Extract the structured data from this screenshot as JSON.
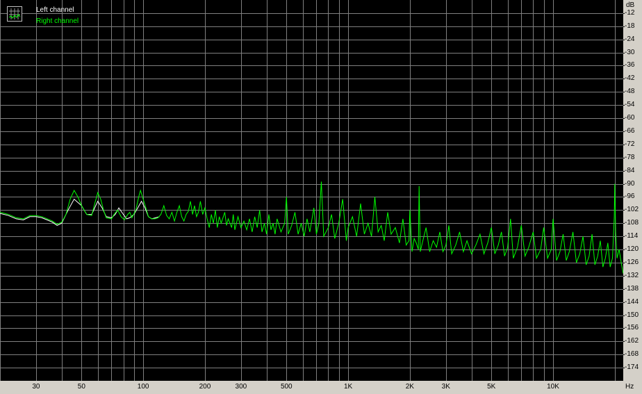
{
  "chart_data": {
    "type": "line",
    "xlabel": "Hz",
    "ylabel": "dB",
    "xscale": "log",
    "xlim": [
      20,
      22000
    ],
    "ylim": [
      -180,
      -6
    ],
    "grid": true,
    "legend_position": "top-left",
    "background_color": "#000000",
    "grid_color": "#808080",
    "x_tick_labels": [
      {
        "value": 30,
        "label": "30"
      },
      {
        "value": 50,
        "label": "50"
      },
      {
        "value": 100,
        "label": "100"
      },
      {
        "value": 200,
        "label": "200"
      },
      {
        "value": 300,
        "label": "300"
      },
      {
        "value": 500,
        "label": "500"
      },
      {
        "value": 1000,
        "label": "1K"
      },
      {
        "value": 2000,
        "label": "2K"
      },
      {
        "value": 3000,
        "label": "3K"
      },
      {
        "value": 5000,
        "label": "5K"
      },
      {
        "value": 10000,
        "label": "10K"
      }
    ],
    "x_minor_ticks": [
      20,
      40,
      60,
      70,
      80,
      90,
      400,
      600,
      700,
      800,
      900,
      4000,
      6000,
      7000,
      8000,
      9000,
      20000
    ],
    "y_ticks": [
      -12,
      -18,
      -24,
      -30,
      -36,
      -42,
      -48,
      -54,
      -60,
      -66,
      -72,
      -78,
      -84,
      -90,
      -96,
      -102,
      -108,
      -114,
      -120,
      -126,
      -132,
      -138,
      -144,
      -150,
      -156,
      -162,
      -168,
      -174
    ],
    "series": [
      {
        "name": "Left channel",
        "color": "#ffffff",
        "points": [
          [
            20,
            -103.5
          ],
          [
            22,
            -104.5
          ],
          [
            24,
            -106
          ],
          [
            26,
            -106.5
          ],
          [
            28,
            -105
          ],
          [
            30,
            -105
          ],
          [
            32,
            -105.5
          ],
          [
            34,
            -106.5
          ],
          [
            36,
            -107.5
          ],
          [
            38,
            -109
          ],
          [
            40,
            -108
          ],
          [
            43,
            -102
          ],
          [
            46,
            -97
          ],
          [
            50,
            -100
          ],
          [
            53,
            -104
          ],
          [
            56,
            -104
          ],
          [
            60,
            -98
          ],
          [
            63,
            -101
          ],
          [
            66,
            -105
          ],
          [
            70,
            -105.5
          ],
          [
            73,
            -104
          ],
          [
            76,
            -101
          ],
          [
            80,
            -104
          ],
          [
            83,
            -106
          ],
          [
            86,
            -105.5
          ],
          [
            90,
            -104
          ],
          [
            94,
            -101
          ],
          [
            98,
            -98
          ],
          [
            102,
            -101
          ],
          [
            106,
            -105
          ],
          [
            110,
            -106
          ],
          [
            115,
            -105.5
          ],
          [
            120,
            -105
          ]
        ]
      },
      {
        "name": "Right channel",
        "color": "#00ff00",
        "points": [
          [
            20,
            -103
          ],
          [
            22,
            -104
          ],
          [
            24,
            -105.5
          ],
          [
            26,
            -106
          ],
          [
            28,
            -104.5
          ],
          [
            30,
            -104.5
          ],
          [
            32,
            -105
          ],
          [
            34,
            -106
          ],
          [
            36,
            -107
          ],
          [
            38,
            -108.5
          ],
          [
            40,
            -107.5
          ],
          [
            42,
            -104
          ],
          [
            44,
            -97
          ],
          [
            46,
            -93
          ],
          [
            48,
            -96
          ],
          [
            50,
            -100
          ],
          [
            53,
            -104
          ],
          [
            56,
            -104.5
          ],
          [
            58,
            -99
          ],
          [
            60,
            -94
          ],
          [
            62,
            -97
          ],
          [
            64,
            -102
          ],
          [
            66,
            -105.5
          ],
          [
            70,
            -106
          ],
          [
            72,
            -104
          ],
          [
            75,
            -102
          ],
          [
            78,
            -105
          ],
          [
            81,
            -106.5
          ],
          [
            84,
            -104
          ],
          [
            86,
            -103
          ],
          [
            88,
            -105.5
          ],
          [
            92,
            -102
          ],
          [
            95,
            -96
          ],
          [
            97,
            -93
          ],
          [
            100,
            -97
          ],
          [
            103,
            -101
          ],
          [
            106,
            -105
          ],
          [
            110,
            -106
          ],
          [
            114,
            -106
          ],
          [
            118,
            -105.5
          ],
          [
            122,
            -104
          ],
          [
            126,
            -100
          ],
          [
            130,
            -104.5
          ],
          [
            134,
            -106
          ],
          [
            138,
            -103
          ],
          [
            142,
            -107
          ],
          [
            146,
            -103
          ],
          [
            150,
            -100
          ],
          [
            154,
            -105
          ],
          [
            158,
            -107
          ],
          [
            162,
            -104
          ],
          [
            166,
            -102.5
          ],
          [
            170,
            -98
          ],
          [
            174,
            -104
          ],
          [
            178,
            -100
          ],
          [
            182,
            -105
          ],
          [
            186,
            -103
          ],
          [
            190,
            -98
          ],
          [
            195,
            -104
          ],
          [
            200,
            -101
          ],
          [
            205,
            -106
          ],
          [
            210,
            -110
          ],
          [
            215,
            -104
          ],
          [
            220,
            -108
          ],
          [
            225,
            -102
          ],
          [
            230,
            -110
          ],
          [
            235,
            -105
          ],
          [
            240,
            -108
          ],
          [
            250,
            -103
          ],
          [
            255,
            -109
          ],
          [
            260,
            -106
          ],
          [
            270,
            -110
          ],
          [
            275,
            -104
          ],
          [
            280,
            -111
          ],
          [
            290,
            -105
          ],
          [
            300,
            -110
          ],
          [
            310,
            -107
          ],
          [
            320,
            -111
          ],
          [
            330,
            -106
          ],
          [
            340,
            -112
          ],
          [
            350,
            -105
          ],
          [
            360,
            -110
          ],
          [
            370,
            -102
          ],
          [
            380,
            -112
          ],
          [
            390,
            -108
          ],
          [
            400,
            -113
          ],
          [
            410,
            -104
          ],
          [
            420,
            -111
          ],
          [
            430,
            -108
          ],
          [
            440,
            -113
          ],
          [
            450,
            -106
          ],
          [
            470,
            -112
          ],
          [
            490,
            -108
          ],
          [
            500,
            -96
          ],
          [
            510,
            -113
          ],
          [
            530,
            -109
          ],
          [
            550,
            -103
          ],
          [
            570,
            -113
          ],
          [
            590,
            -108
          ],
          [
            610,
            -114
          ],
          [
            630,
            -106
          ],
          [
            650,
            -112
          ],
          [
            680,
            -101
          ],
          [
            700,
            -113
          ],
          [
            720,
            -108
          ],
          [
            740,
            -89
          ],
          [
            760,
            -114
          ],
          [
            800,
            -110
          ],
          [
            830,
            -104
          ],
          [
            860,
            -115
          ],
          [
            900,
            -108
          ],
          [
            940,
            -97
          ],
          [
            980,
            -116
          ],
          [
            1000,
            -110
          ],
          [
            1050,
            -105
          ],
          [
            1100,
            -114
          ],
          [
            1150,
            -99
          ],
          [
            1200,
            -113
          ],
          [
            1250,
            -108
          ],
          [
            1300,
            -114
          ],
          [
            1350,
            -96
          ],
          [
            1400,
            -112
          ],
          [
            1450,
            -109
          ],
          [
            1500,
            -116
          ],
          [
            1560,
            -103
          ],
          [
            1620,
            -113
          ],
          [
            1700,
            -110
          ],
          [
            1780,
            -117
          ],
          [
            1850,
            -106
          ],
          [
            1920,
            -118
          ],
          [
            1980,
            -116
          ],
          [
            2000,
            -102
          ],
          [
            2050,
            -121
          ],
          [
            2100,
            -115
          ],
          [
            2150,
            -117
          ],
          [
            2200,
            -120
          ],
          [
            2220,
            -91
          ],
          [
            2250,
            -121
          ],
          [
            2300,
            -117
          ],
          [
            2400,
            -110
          ],
          [
            2500,
            -121
          ],
          [
            2600,
            -116
          ],
          [
            2700,
            -119
          ],
          [
            2800,
            -112
          ],
          [
            2900,
            -121
          ],
          [
            3000,
            -118
          ],
          [
            3100,
            -109
          ],
          [
            3200,
            -122
          ],
          [
            3350,
            -118
          ],
          [
            3500,
            -112
          ],
          [
            3650,
            -121
          ],
          [
            3800,
            -116
          ],
          [
            4000,
            -122
          ],
          [
            4200,
            -118
          ],
          [
            4400,
            -113
          ],
          [
            4600,
            -122
          ],
          [
            4800,
            -117
          ],
          [
            5000,
            -110
          ],
          [
            5200,
            -122
          ],
          [
            5400,
            -118
          ],
          [
            5600,
            -112
          ],
          [
            5800,
            -123
          ],
          [
            6000,
            -119
          ],
          [
            6200,
            -106
          ],
          [
            6400,
            -124
          ],
          [
            6700,
            -119
          ],
          [
            7000,
            -109
          ],
          [
            7300,
            -123
          ],
          [
            7600,
            -119
          ],
          [
            8000,
            -112
          ],
          [
            8300,
            -124
          ],
          [
            8700,
            -120
          ],
          [
            9000,
            -110
          ],
          [
            9400,
            -124
          ],
          [
            9800,
            -120
          ],
          [
            10000,
            -106
          ],
          [
            10400,
            -125
          ],
          [
            10800,
            -121
          ],
          [
            11200,
            -113
          ],
          [
            11600,
            -125
          ],
          [
            12000,
            -121
          ],
          [
            12500,
            -112
          ],
          [
            13000,
            -126
          ],
          [
            13500,
            -122
          ],
          [
            14000,
            -114
          ],
          [
            14500,
            -127
          ],
          [
            15000,
            -123
          ],
          [
            15500,
            -113
          ],
          [
            16000,
            -127
          ],
          [
            16500,
            -123
          ],
          [
            17000,
            -116
          ],
          [
            17500,
            -128
          ],
          [
            18000,
            -124
          ],
          [
            18500,
            -117
          ],
          [
            19000,
            -128
          ],
          [
            19500,
            -124
          ],
          [
            19900,
            -105
          ],
          [
            20000,
            -90
          ],
          [
            20200,
            -112
          ],
          [
            20500,
            -124
          ],
          [
            21000,
            -120
          ],
          [
            21500,
            -126
          ],
          [
            22000,
            -131
          ]
        ]
      }
    ]
  }
}
